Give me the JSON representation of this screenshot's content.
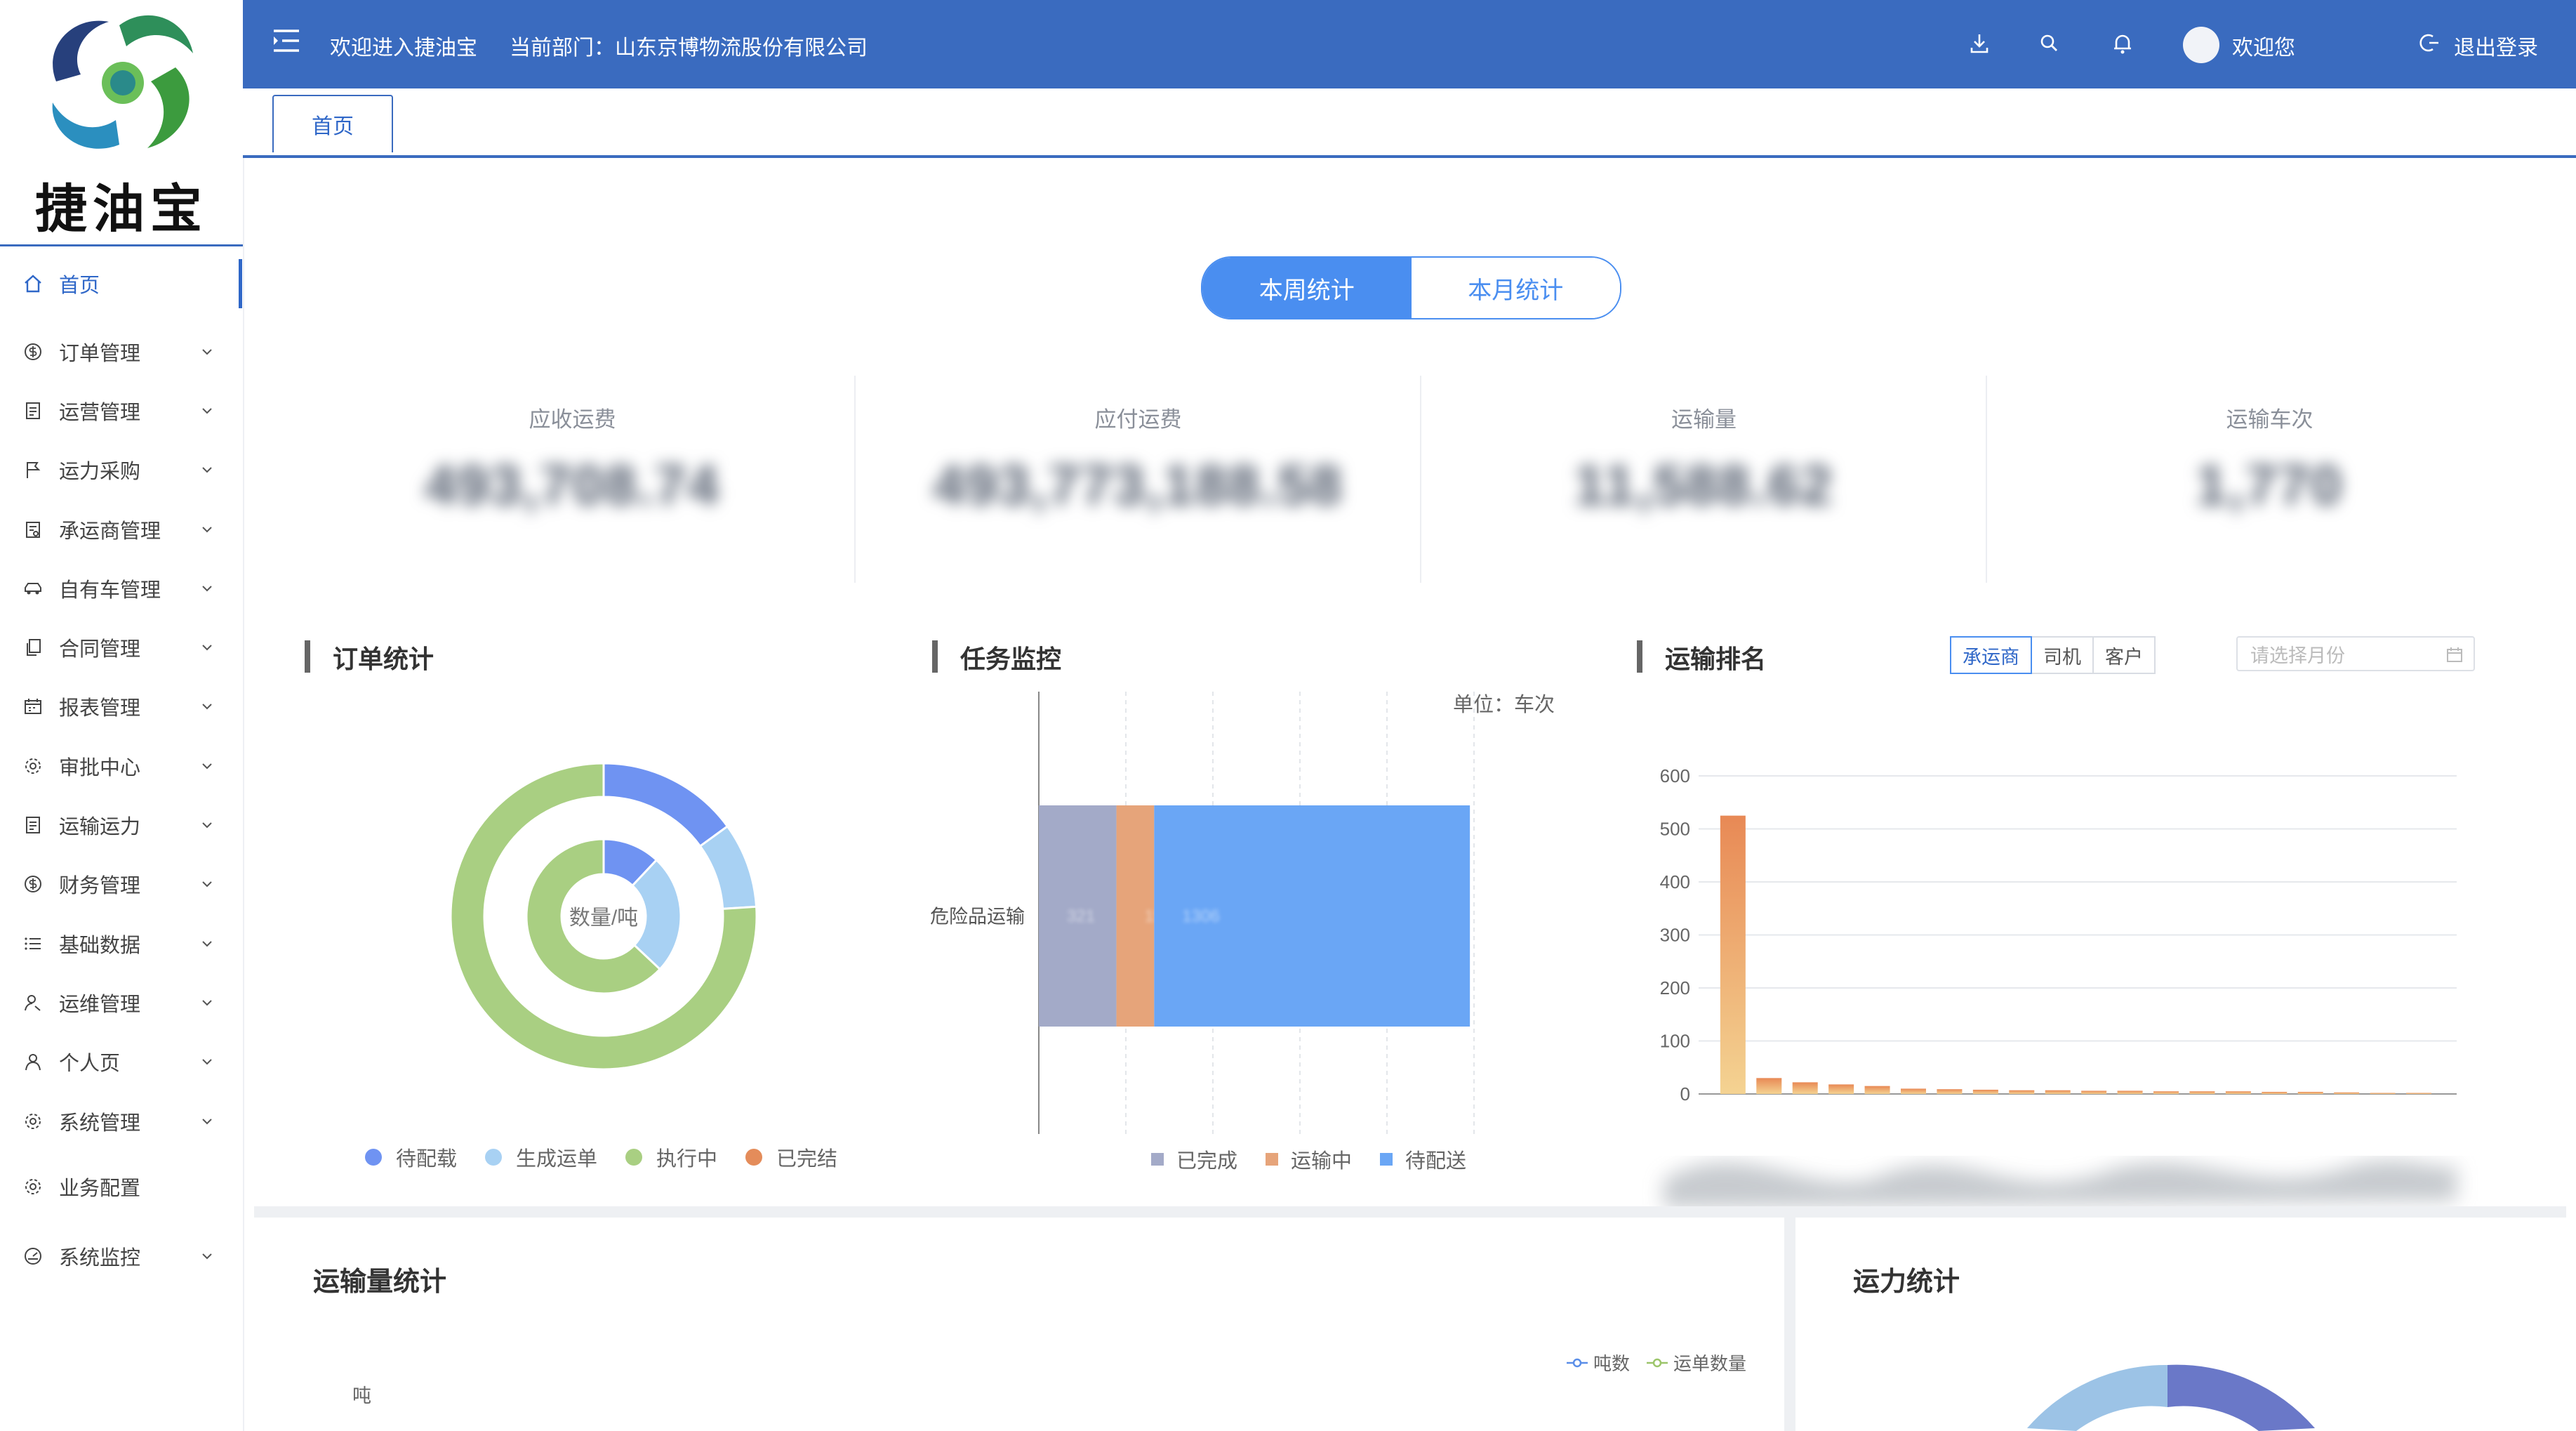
{
  "app": {
    "logo_name": "捷油宝"
  },
  "header": {
    "welcome": "欢迎进入捷油宝",
    "department_label": "当前部门：山东京博物流股份有限公司",
    "user_greeting": "欢迎您",
    "logout_label": "退出登录",
    "icons": [
      "menu-toggle-icon",
      "download-icon",
      "search-icon",
      "bell-icon",
      "avatar",
      "logout-icon"
    ]
  },
  "tabs": {
    "home": "首页"
  },
  "sidebar": {
    "items": [
      {
        "label": "首页",
        "icon": "home-icon",
        "active": true
      },
      {
        "label": "订单管理",
        "icon": "dollar-circle-icon"
      },
      {
        "label": "运营管理",
        "icon": "document-icon"
      },
      {
        "label": "运力采购",
        "icon": "flag-icon"
      },
      {
        "label": "承运商管理",
        "icon": "clipboard-icon"
      },
      {
        "label": "自有车管理",
        "icon": "car-icon"
      },
      {
        "label": "合同管理",
        "icon": "copy-icon"
      },
      {
        "label": "报表管理",
        "icon": "calendar-icon"
      },
      {
        "label": "审批中心",
        "icon": "gear-icon"
      },
      {
        "label": "运输运力",
        "icon": "document-icon"
      },
      {
        "label": "财务管理",
        "icon": "dollar-circle-icon"
      },
      {
        "label": "基础数据",
        "icon": "list-icon"
      },
      {
        "label": "运维管理",
        "icon": "user-wrench-icon"
      },
      {
        "label": "个人页",
        "icon": "user-icon"
      },
      {
        "label": "系统管理",
        "icon": "gear-icon"
      },
      {
        "label": "业务配置",
        "icon": "gear-icon"
      },
      {
        "label": "系统监控",
        "icon": "dashboard-icon"
      }
    ]
  },
  "period_toggle": {
    "week": "本周统计",
    "month": "本月统计",
    "selected": "week"
  },
  "kpis": [
    {
      "label": "应收运费",
      "value": "493,708.74"
    },
    {
      "label": "应付运费",
      "value": "493,773,188.58"
    },
    {
      "label": "运输量",
      "value": "11,588.62"
    },
    {
      "label": "运输车次",
      "value": "1,770"
    }
  ],
  "order_stats": {
    "title": "订单统计",
    "center_label": "数量/吨",
    "legend": [
      "待配载",
      "生成运单",
      "执行中",
      "已完结"
    ],
    "colors": {
      "待配载": "#6f93f2",
      "生成运单": "#a8d1f3",
      "执行中": "#a9cf82",
      "已完结": "#e48c5a"
    }
  },
  "task_monitor": {
    "title": "任务监控",
    "unit": "单位：车次",
    "category": "危险品运输",
    "legend": [
      "已完成",
      "运输中",
      "待配送"
    ],
    "colors": {
      "已完成": "#a3aac8",
      "运输中": "#e6a47a",
      "待配送": "#6aa6f5"
    }
  },
  "transport_ranking": {
    "title": "运输排名",
    "tabs": [
      "承运商",
      "司机",
      "客户"
    ],
    "selected_tab": "承运商",
    "month_placeholder": "请选择月份"
  },
  "transport_volume": {
    "title": "运输量统计",
    "y_unit": "吨",
    "legend": [
      "吨数",
      "运单数量"
    ]
  },
  "capacity": {
    "title": "运力统计"
  },
  "chart_data": [
    {
      "type": "pie",
      "title": "订单统计",
      "rings": [
        {
          "ring": "outer",
          "categories": [
            "待配载",
            "生成运单",
            "执行中"
          ],
          "values": [
            15,
            9,
            76
          ]
        },
        {
          "ring": "inner",
          "categories": [
            "待配载",
            "生成运单",
            "执行中"
          ],
          "values": [
            12,
            25,
            63
          ]
        }
      ]
    },
    {
      "type": "bar",
      "orientation": "horizontal",
      "stacked": true,
      "title": "任务监控",
      "categories": [
        "危险品运输"
      ],
      "series": [
        {
          "name": "已完成",
          "values": [
            321
          ]
        },
        {
          "name": "运输中",
          "values": [
            156
          ]
        },
        {
          "name": "待配送",
          "values": [
            1306
          ]
        }
      ],
      "xlim": [
        0,
        1800
      ],
      "grid": true,
      "legend": "bottom"
    },
    {
      "type": "bar",
      "title": "运输排名",
      "ylim": [
        0,
        600
      ],
      "yticks": [
        0,
        100,
        200,
        300,
        400,
        500,
        600
      ],
      "values": [
        525,
        30,
        22,
        18,
        15,
        10,
        9,
        8,
        7,
        7,
        6,
        6,
        5,
        5,
        5,
        4,
        4,
        3,
        2,
        2
      ]
    }
  ]
}
